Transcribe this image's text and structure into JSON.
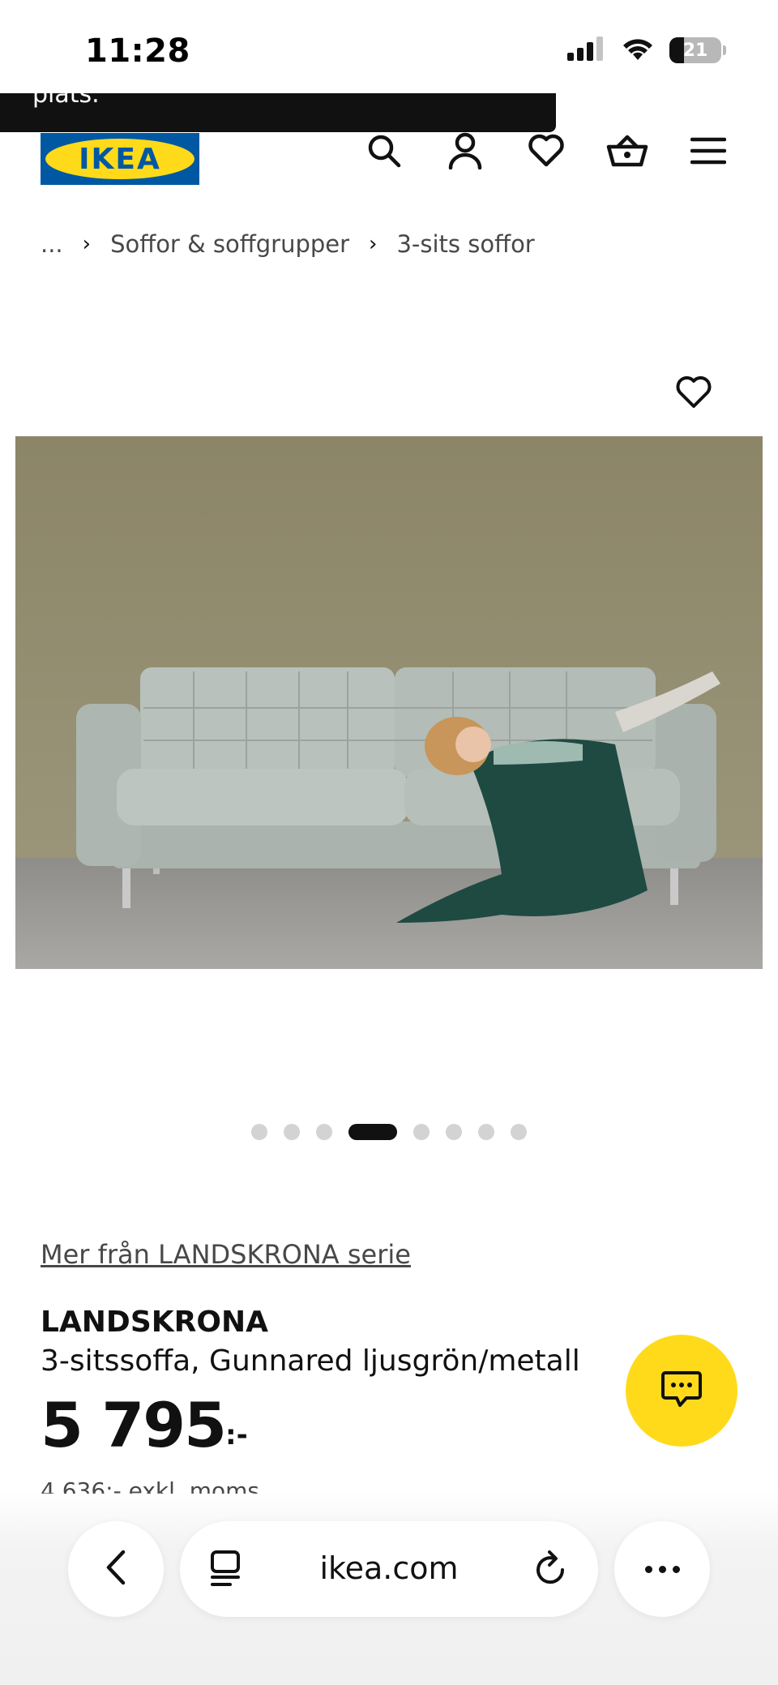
{
  "status_bar": {
    "time": "11:28",
    "battery_level": "21",
    "icons": [
      "cellular-signal-icon",
      "wifi-icon",
      "battery-icon"
    ]
  },
  "toast": {
    "text": "plats."
  },
  "header": {
    "logo_text": "IKEA",
    "icons": [
      "search-icon",
      "account-icon",
      "favorites-icon",
      "cart-icon",
      "menu-icon"
    ]
  },
  "breadcrumb": {
    "ellipsis": "...",
    "items": [
      {
        "label": "Soffor & soffgrupper"
      },
      {
        "label": "3-sits soffor"
      }
    ]
  },
  "gallery": {
    "favorite_icon": "heart-icon",
    "dot_count": 8,
    "active_dot_index": 3
  },
  "product": {
    "series_link": "Mer från LANDSKRONA serie",
    "name": "LANDSKRONA",
    "description": "3-sitssoffa, Gunnared ljusgrön/metall",
    "price_main": "5 795",
    "price_suffix": ":-",
    "price_excl_vat": "4 636:- exkl. moms"
  },
  "chat": {
    "icon": "chat-icon"
  },
  "browser": {
    "url": "ikea.com",
    "icons": [
      "back-icon",
      "tabs-icon",
      "reload-icon",
      "more-icon"
    ]
  },
  "colors": {
    "ikea_blue": "#0058a3",
    "ikea_yellow": "#ffda1a",
    "text_primary": "#111111",
    "text_secondary": "#484848"
  }
}
